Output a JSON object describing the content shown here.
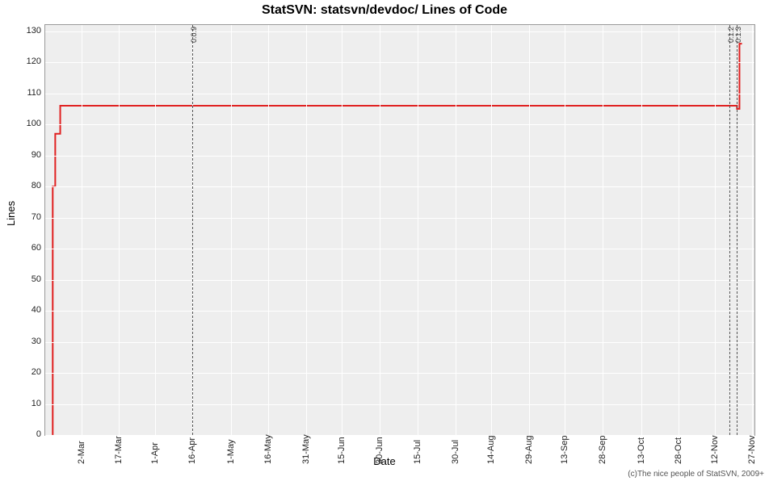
{
  "chart_data": {
    "type": "line",
    "title": "StatSVN: statsvn/devdoc/ Lines of Code",
    "xlabel": "Date",
    "ylabel": "Lines",
    "ylim": [
      0,
      132
    ],
    "credit": "(c)The nice people of StatSVN, 2009+",
    "yticks": [
      0,
      10,
      20,
      30,
      40,
      50,
      60,
      70,
      80,
      90,
      100,
      110,
      120,
      130
    ],
    "xticks": [
      "2-Mar",
      "17-Mar",
      "1-Apr",
      "16-Apr",
      "1-May",
      "16-May",
      "31-May",
      "15-Jun",
      "30-Jun",
      "15-Jul",
      "30-Jul",
      "14-Aug",
      "29-Aug",
      "13-Sep",
      "28-Sep",
      "13-Oct",
      "28-Oct",
      "12-Nov",
      "27-Nov"
    ],
    "markers": [
      {
        "label": "0.0.9",
        "xpos": "16-Apr"
      },
      {
        "label": "0.1.2",
        "xpos": "18-Nov"
      },
      {
        "label": "0.1.3",
        "xpos": "21-Nov"
      }
    ],
    "series": [
      {
        "name": "Lines of Code",
        "color": "#e02020",
        "points": [
          {
            "x": "21-Feb",
            "y": 0
          },
          {
            "x": "21-Feb",
            "y": 80
          },
          {
            "x": "22-Feb",
            "y": 97
          },
          {
            "x": "24-Feb",
            "y": 106
          },
          {
            "x": "20-Nov",
            "y": 106
          },
          {
            "x": "21-Nov",
            "y": 105
          },
          {
            "x": "22-Nov",
            "y": 126
          },
          {
            "x": "23-Nov",
            "y": 126
          }
        ]
      }
    ]
  }
}
